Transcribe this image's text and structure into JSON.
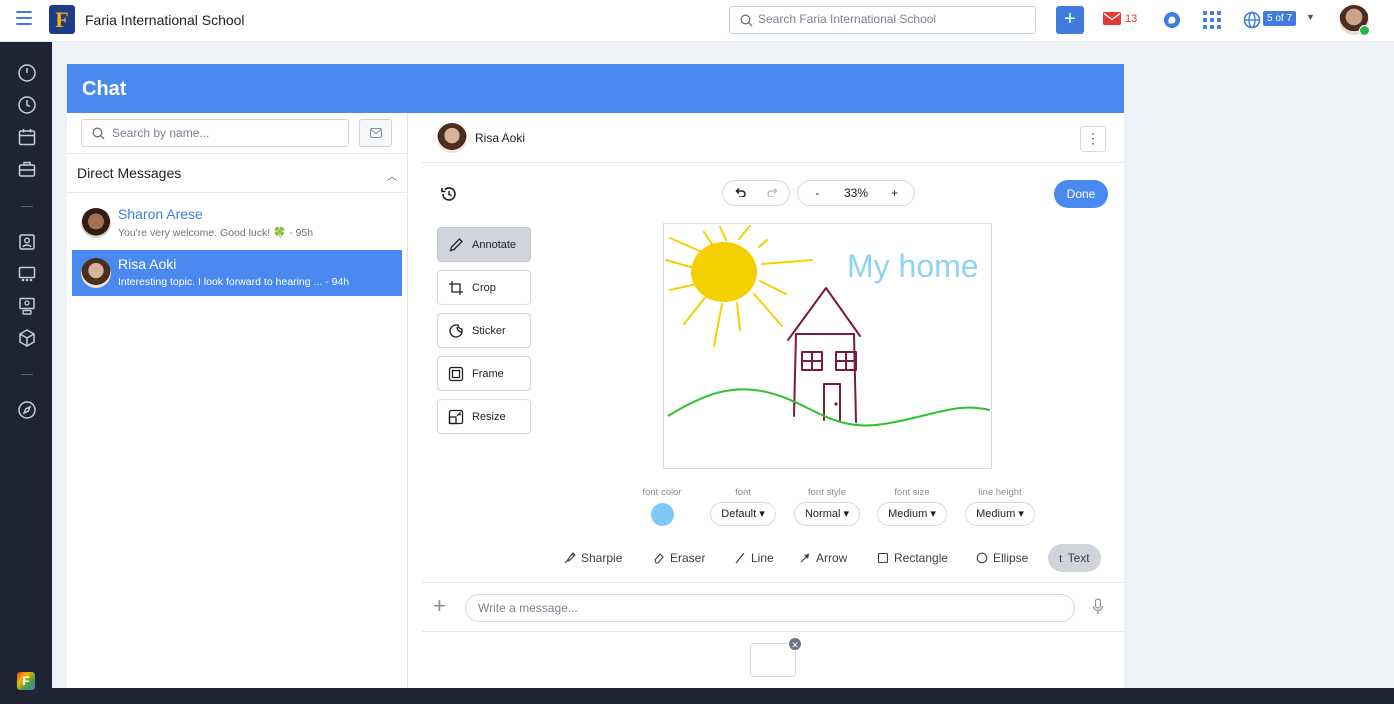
{
  "topbar": {
    "school_name": "Faria International School",
    "logo_letter": "F",
    "search_placeholder": "Search Faria International School",
    "add_label": "+",
    "mail_count": "13",
    "page_indicator": "5 of 7"
  },
  "chat": {
    "title": "Chat",
    "search_placeholder": "Search by name...",
    "section_title": "Direct Messages",
    "conversations": [
      {
        "name": "Sharon Arese",
        "preview": "You're very welcome. Good luck! 🍀 - 95h"
      },
      {
        "name": "Risa Aoki",
        "preview": "Interesting topic. I look forward to hearing ...   - 94h"
      }
    ]
  },
  "editor": {
    "contact_name": "Risa Aoki",
    "kebab": "⋮",
    "zoom_minus": "-",
    "zoom_level": "33%",
    "zoom_plus": "+",
    "done_label": "Done",
    "tools": [
      {
        "label": "Annotate",
        "icon": "pencil-icon"
      },
      {
        "label": "Crop",
        "icon": "crop-icon"
      },
      {
        "label": "Sticker",
        "icon": "sticker-icon"
      },
      {
        "label": "Frame",
        "icon": "frame-icon"
      },
      {
        "label": "Resize",
        "icon": "resize-icon"
      }
    ],
    "canvas_text": "My home",
    "options": {
      "font_color_label": "font color",
      "font_color": "#7fcaf4",
      "font_label": "font",
      "font_value": "Default ▾",
      "font_style_label": "font style",
      "font_style_value": "Normal ▾",
      "font_size_label": "font size",
      "font_size_value": "Medium ▾",
      "line_height_label": "line height",
      "line_height_value": "Medium ▾"
    },
    "draw_tools": [
      {
        "label": "Sharpie",
        "icon": "sharpie-icon"
      },
      {
        "label": "Eraser",
        "icon": "eraser-icon"
      },
      {
        "label": "Line",
        "icon": "line-icon"
      },
      {
        "label": "Arrow",
        "icon": "arrow-icon"
      },
      {
        "label": "Rectangle",
        "icon": "rectangle-icon"
      },
      {
        "label": "Ellipse",
        "icon": "ellipse-icon"
      },
      {
        "label": "Text",
        "icon": "text-icon"
      }
    ],
    "message_placeholder": "Write a message...",
    "attachment_remove": "✕"
  },
  "colors": {
    "accent": "#4a8af0",
    "brand_dark": "#1e2433",
    "mail_red": "#e53935"
  }
}
